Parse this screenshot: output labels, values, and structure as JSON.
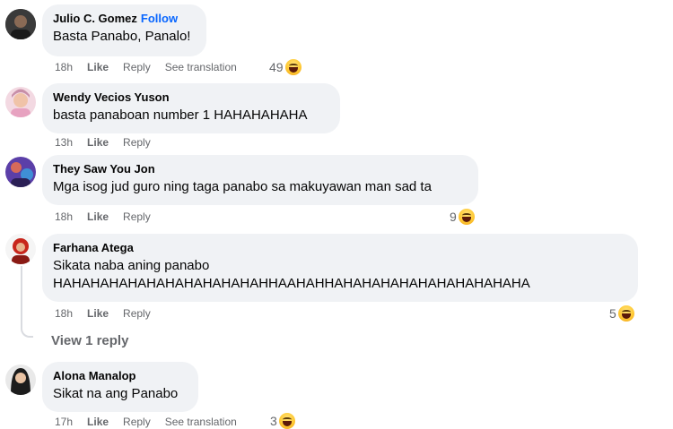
{
  "comments": [
    {
      "name": "Julio C. Gomez",
      "follow_label": "Follow",
      "text": "Basta Panabo, Panalo!",
      "time": "18h",
      "like": "Like",
      "reply": "Reply",
      "translate": "See translation",
      "reaction_count": "49"
    },
    {
      "name": "Wendy Vecios Yuson",
      "text": "basta panaboan number 1 HAHAHAHAHA",
      "time": "13h",
      "like": "Like",
      "reply": "Reply"
    },
    {
      "name": "They Saw You Jon",
      "text": "Mga isog jud guro ning taga panabo sa makuyawan man sad ta",
      "time": "18h",
      "like": "Like",
      "reply": "Reply",
      "reaction_count": "9"
    },
    {
      "name": "Farhana Atega",
      "text_line1": "Sikata naba aning panabo",
      "text_line2": "HAHAHAHAHAHAHAHAHAHAHAHHAAHAHHAHAHAHAHAHAHAHAHAHAHA",
      "time": "18h",
      "like": "Like",
      "reply": "Reply",
      "reaction_count": "5",
      "view_replies": "View 1 reply"
    },
    {
      "name": "Alona Manalop",
      "text": "Sikat na ang Panabo",
      "time": "17h",
      "like": "Like",
      "reply": "Reply",
      "translate": "See translation",
      "reaction_count": "3"
    }
  ],
  "icons": {
    "reaction": "haha-emoji-icon"
  },
  "colors": {
    "bubble": "#f0f2f5",
    "link": "#0866ff",
    "meta": "#65676b"
  }
}
